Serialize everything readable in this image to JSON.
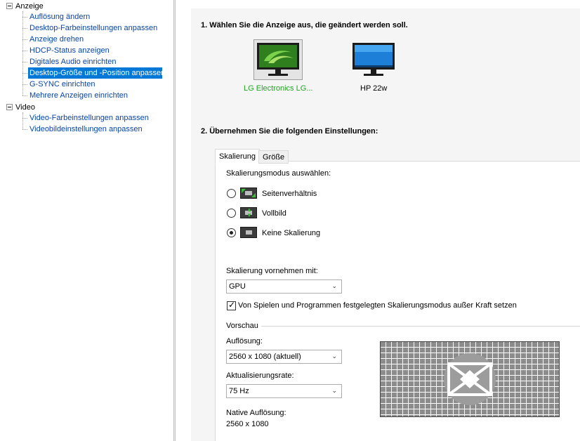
{
  "tree": {
    "categories": [
      {
        "label": "Anzeige",
        "items": [
          {
            "label": "Auflösung ändern"
          },
          {
            "label": "Desktop-Farbeinstellungen anpassen"
          },
          {
            "label": "Anzeige drehen"
          },
          {
            "label": "HDCP-Status anzeigen"
          },
          {
            "label": "Digitales Audio einrichten"
          },
          {
            "label": "Desktop-Größe und -Position anpassen",
            "selected": true
          },
          {
            "label": "G-SYNC einrichten"
          },
          {
            "label": "Mehrere Anzeigen einrichten"
          }
        ]
      },
      {
        "label": "Video",
        "items": [
          {
            "label": "Video-Farbeinstellungen anpassen"
          },
          {
            "label": "Videobildeinstellungen anpassen"
          }
        ]
      }
    ]
  },
  "step1": {
    "title": "1. Wählen Sie die Anzeige aus, die geändert werden soll.",
    "displays": [
      {
        "label": "LG Electronics LG...",
        "selected": true,
        "icon": "nvidia-monitor-icon"
      },
      {
        "label": "HP 22w",
        "selected": false,
        "icon": "windows-monitor-icon"
      }
    ]
  },
  "step2": {
    "title": "2. Übernehmen Sie die folgenden Einstellungen:"
  },
  "tabs": [
    {
      "label": "Skalierung",
      "active": true
    },
    {
      "label": "Größe",
      "active": false
    }
  ],
  "scaling": {
    "mode_label": "Skalierungsmodus auswählen:",
    "modes": [
      {
        "label": "Seitenverhältnis",
        "checked": false
      },
      {
        "label": "Vollbild",
        "checked": false
      },
      {
        "label": "Keine Skalierung",
        "checked": true
      }
    ],
    "perform_label": "Skalierung vornehmen mit:",
    "perform_value": "GPU",
    "override_label": "Von Spielen und Programmen festgelegten Skalierungsmodus außer Kraft setzen",
    "override_checked": true
  },
  "preview": {
    "group_label": "Vorschau",
    "resolution_label": "Auflösung:",
    "resolution_value": "2560 x 1080 (aktuell)",
    "refresh_label": "Aktualisierungsrate:",
    "refresh_value": "75 Hz",
    "native_label": "Native Auflösung:",
    "native_value": "2560 x 1080"
  },
  "colors": {
    "selected_bg": "#0078d7",
    "link": "#0645ad",
    "nvidia_green": "#3cbd3c",
    "selected_display_label": "#22a322"
  }
}
